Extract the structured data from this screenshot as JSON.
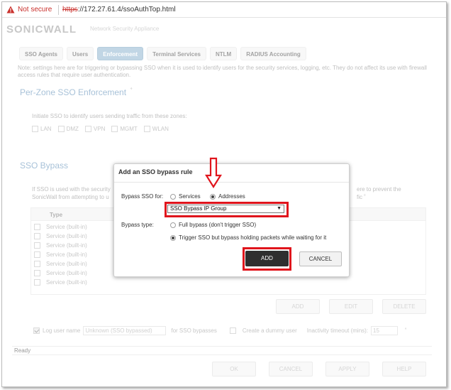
{
  "browser": {
    "security_label": "Not secure",
    "url_scheme": "https",
    "url_rest": "://172.27.61.4/ssoAuthTop.html"
  },
  "header": {
    "brand": "SONICWALL",
    "tagline": "Network Security Appliance"
  },
  "tabs": [
    {
      "label": "SSO Agents",
      "active": false
    },
    {
      "label": "Users",
      "active": false
    },
    {
      "label": "Enforcement",
      "active": true
    },
    {
      "label": "Terminal Services",
      "active": false
    },
    {
      "label": "NTLM",
      "active": false
    },
    {
      "label": "RADIUS Accounting",
      "active": false
    }
  ],
  "note": "Note: settings here are for triggering or bypassing SSO when it is used to identify users for the security services, logging, etc. They do not affect its use with firewall access rules that require user authentication.",
  "per_zone": {
    "title": "Per-Zone SSO Enforcement",
    "caret": "˚",
    "instruction": "Initiate SSO to identify users sending traffic from these zones:",
    "zones": [
      "LAN",
      "DMZ",
      "VPN",
      "MGMT",
      "WLAN"
    ]
  },
  "bypass": {
    "title": "SSO Bypass",
    "text_left_1": "If SSO is used with the security",
    "text_left_2": "SonicWall from attempting to u",
    "text_right_1": "ere to prevent the",
    "text_right_2": "fic",
    "caret": "˚",
    "table": {
      "header_type": "Type",
      "rows": [
        "Service (built-in)",
        "Service (built-in)",
        "Service (built-in)",
        "Service (built-in)",
        "Service (built-in)",
        "Service (built-in)",
        "Service (built-in)"
      ]
    },
    "buttons": {
      "add": "ADD",
      "edit": "EDIT",
      "delete": "DELETE"
    }
  },
  "options": {
    "log_user_name_label": "Log user name",
    "log_user_name_value": "Unknown (SSO bypassed)",
    "for_sso_bypasses": "for SSO bypasses",
    "create_dummy_user": "Create a dummy user",
    "inactivity_timeout_label": "Inactivity timeout (mins):",
    "inactivity_timeout_value": "15",
    "caret": "˚"
  },
  "status": "Ready",
  "footer_buttons": {
    "ok": "OK",
    "cancel": "CANCEL",
    "apply": "APPLY",
    "help": "HELP"
  },
  "dialog": {
    "title": "Add an SSO bypass rule",
    "bypass_for_label": "Bypass SSO for:",
    "opt_services": "Services",
    "opt_addresses": "Addresses",
    "selected_for": "Addresses",
    "select_value": "SSO Bypass IP Group",
    "bypass_type_label": "Bypass type:",
    "opt_full": "Full bypass (don't trigger SSO)",
    "opt_trigger": "Trigger SSO but bypass holding packets while waiting for it",
    "selected_type": "trigger",
    "add_label": "ADD",
    "cancel_label": "CANCEL"
  },
  "colors": {
    "accent_tab": "#8fb5cf",
    "section_title": "#5f8fb8",
    "highlight": "#e0141c",
    "add_button": "#2f2f2f"
  }
}
